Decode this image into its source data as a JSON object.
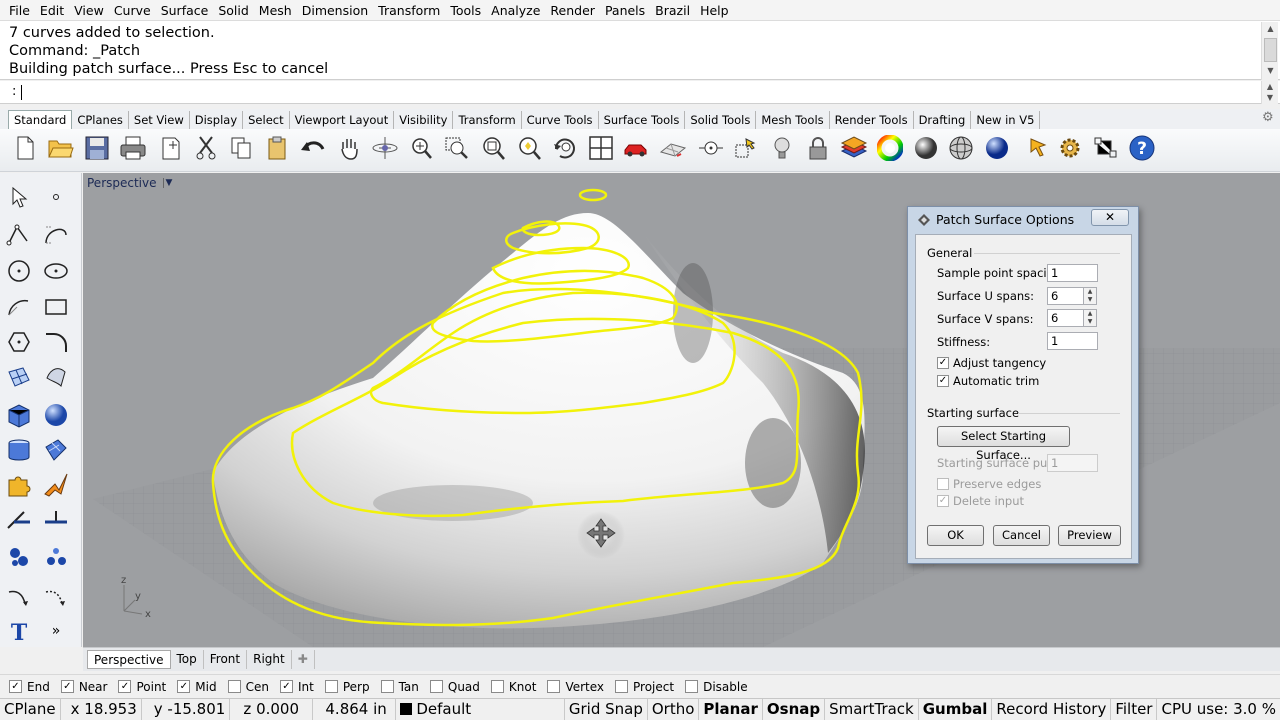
{
  "menu": [
    "File",
    "Edit",
    "View",
    "Curve",
    "Surface",
    "Solid",
    "Mesh",
    "Dimension",
    "Transform",
    "Tools",
    "Analyze",
    "Render",
    "Panels",
    "Brazil",
    "Help"
  ],
  "command_history": [
    "7 curves added to selection.",
    "Command: _Patch",
    "Building patch surface... Press Esc to cancel"
  ],
  "command_prompt": ":",
  "toolbar_tabs": [
    "Standard",
    "CPlanes",
    "Set View",
    "Display",
    "Select",
    "Viewport Layout",
    "Visibility",
    "Transform",
    "Curve Tools",
    "Surface Tools",
    "Solid Tools",
    "Mesh Tools",
    "Render Tools",
    "Drafting",
    "New in V5"
  ],
  "toolbar_icons": [
    "new-file-icon",
    "open-folder-icon",
    "save-icon",
    "print-icon",
    "import-icon",
    "cut-icon",
    "copy-icon",
    "paste-icon",
    "undo-icon",
    "pan-hand-icon",
    "rotate-view-icon",
    "zoom-dynamic-icon",
    "zoom-window-icon",
    "zoom-extents-icon",
    "zoom-selected-icon",
    "rotate-3d-icon",
    "grid-4-views-icon",
    "car-named-view-icon",
    "plane-icon",
    "point-on-curve-icon",
    "gumball-select-icon",
    "bulb-light-icon",
    "lock-icon",
    "layers-icon",
    "color-wheel-icon",
    "render-sphere-icon",
    "wire-sphere-icon",
    "blue-sphere-icon",
    "cursor-flag-icon",
    "settings-gear-icon",
    "snap-grid-icon",
    "help-icon"
  ],
  "palette_icons": [
    "select-arrow-icon",
    "point-icon",
    "polyline-icon",
    "curve-icon",
    "circle-icon",
    "ellipse-icon",
    "arc-icon",
    "rectangle-icon",
    "polygon-icon",
    "fillet-icon",
    "surface-from-points-icon",
    "extrude-surface-icon",
    "box-icon",
    "sphere-icon",
    "cylinder-icon",
    "surface-patch-icon",
    "transform-puzzle-icon",
    "explode-icon",
    "trim-icon",
    "split-icon",
    "group-icon",
    "array-icon",
    "curve-from-object-icon",
    "dimension-icon",
    "text-icon",
    "more-icon"
  ],
  "viewport": {
    "title": "Perspective",
    "axis_labels": {
      "x": "x",
      "y": "y",
      "z": "z"
    }
  },
  "viewport_tabs": [
    "Perspective",
    "Top",
    "Front",
    "Right"
  ],
  "osnaps": [
    {
      "label": "End",
      "checked": true
    },
    {
      "label": "Near",
      "checked": true
    },
    {
      "label": "Point",
      "checked": true
    },
    {
      "label": "Mid",
      "checked": true
    },
    {
      "label": "Cen",
      "checked": false
    },
    {
      "label": "Int",
      "checked": true
    },
    {
      "label": "Perp",
      "checked": false
    },
    {
      "label": "Tan",
      "checked": false
    },
    {
      "label": "Quad",
      "checked": false
    },
    {
      "label": "Knot",
      "checked": false
    },
    {
      "label": "Vertex",
      "checked": false
    },
    {
      "label": "Project",
      "checked": false
    },
    {
      "label": "Disable",
      "checked": false
    }
  ],
  "status": {
    "cplane": "CPlane",
    "x": "x 18.953",
    "y": "y -15.801",
    "z": "z 0.000",
    "distance": "4.864 in",
    "layer": "Default",
    "grid_snap": "Grid Snap",
    "ortho": "Ortho",
    "planar": "Planar",
    "osnap": "Osnap",
    "smarttrack": "SmartTrack",
    "gumball": "Gumbal",
    "record_history": "Record History",
    "filter": "Filter",
    "cpu": "CPU use: 3.0 %"
  },
  "dialog": {
    "title": "Patch Surface Options",
    "close_label": "✕",
    "general_header": "General",
    "sample_spacing_label": "Sample point spacing:",
    "sample_spacing_value": "1",
    "u_spans_label": "Surface U spans:",
    "u_spans_value": "6",
    "v_spans_label": "Surface V spans:",
    "v_spans_value": "6",
    "stiffness_label": "Stiffness:",
    "stiffness_value": "1",
    "adjust_tangency_label": "Adjust tangency",
    "automatic_trim_label": "Automatic trim",
    "starting_surface_header": "Starting surface",
    "select_starting_surface_label": "Select Starting Surface...",
    "starting_pull_label": "Starting surface pull:",
    "starting_pull_value": "1",
    "preserve_edges_label": "Preserve edges",
    "delete_input_label": "Delete input",
    "ok_label": "OK",
    "cancel_label": "Cancel",
    "preview_label": "Preview"
  },
  "colors": {
    "viewport_bg": "#9d9fa2",
    "selected_curve": "#f2f20a",
    "dialog_frame": "#c8d6e6"
  }
}
